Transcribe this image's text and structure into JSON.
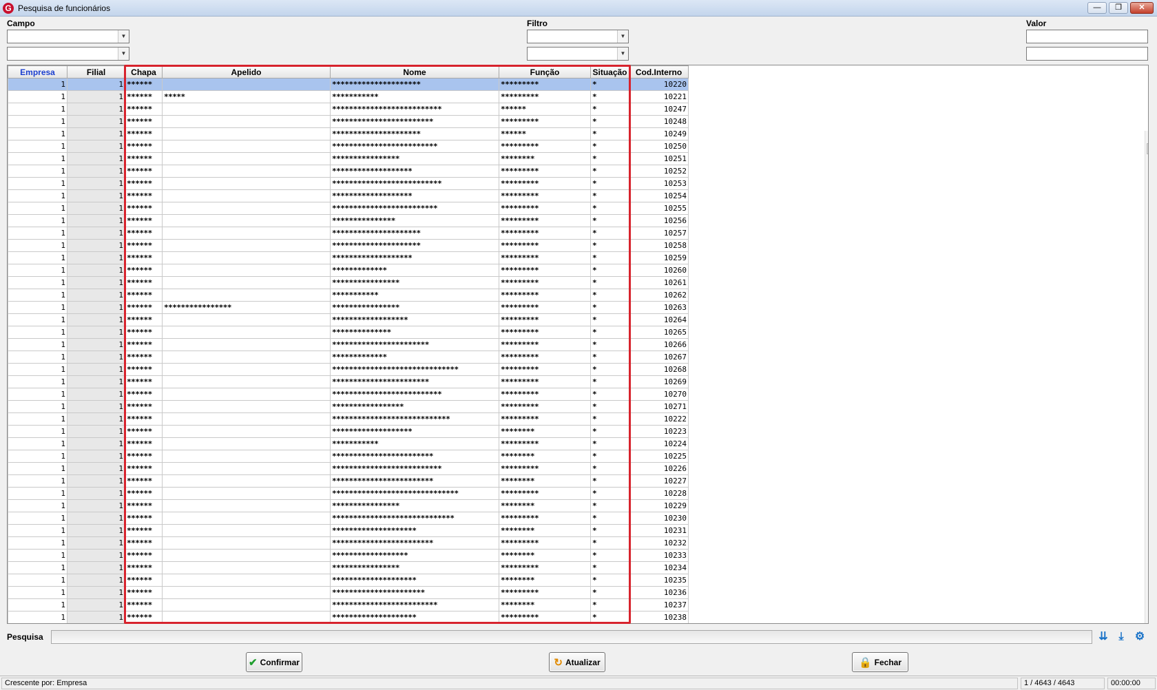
{
  "window": {
    "title": "Pesquisa de funcionários",
    "icon_letter": "G",
    "minimize": "—",
    "restore": "❐",
    "close": "✕"
  },
  "filters": {
    "campo_label": "Campo",
    "filtro_label": "Filtro",
    "valor_label": "Valor"
  },
  "grid": {
    "columns": [
      "Empresa",
      "Filial",
      "Chapa",
      "Apelido",
      "Nome",
      "Função",
      "Situação",
      "Cod.Interno"
    ],
    "rows": [
      [
        "1",
        "1",
        "******",
        "",
        "*********************",
        "*********",
        "*",
        "10220"
      ],
      [
        "1",
        "1",
        "******",
        "*****",
        "***********",
        "*********",
        "*",
        "10221"
      ],
      [
        "1",
        "1",
        "******",
        "",
        "**************************",
        "******",
        "*",
        "10247"
      ],
      [
        "1",
        "1",
        "******",
        "",
        "************************",
        "*********",
        "*",
        "10248"
      ],
      [
        "1",
        "1",
        "******",
        "",
        "*********************",
        "******",
        "*",
        "10249"
      ],
      [
        "1",
        "1",
        "******",
        "",
        "*************************",
        "*********",
        "*",
        "10250"
      ],
      [
        "1",
        "1",
        "******",
        "",
        "****************",
        "********",
        "*",
        "10251"
      ],
      [
        "1",
        "1",
        "******",
        "",
        "*******************",
        "*********",
        "*",
        "10252"
      ],
      [
        "1",
        "1",
        "******",
        "",
        "**************************",
        "*********",
        "*",
        "10253"
      ],
      [
        "1",
        "1",
        "******",
        "",
        "*******************",
        "*********",
        "*",
        "10254"
      ],
      [
        "1",
        "1",
        "******",
        "",
        "*************************",
        "*********",
        "*",
        "10255"
      ],
      [
        "1",
        "1",
        "******",
        "",
        "***************",
        "*********",
        "*",
        "10256"
      ],
      [
        "1",
        "1",
        "******",
        "",
        "*********************",
        "*********",
        "*",
        "10257"
      ],
      [
        "1",
        "1",
        "******",
        "",
        "*********************",
        "*********",
        "*",
        "10258"
      ],
      [
        "1",
        "1",
        "******",
        "",
        "*******************",
        "*********",
        "*",
        "10259"
      ],
      [
        "1",
        "1",
        "******",
        "",
        "*************",
        "*********",
        "*",
        "10260"
      ],
      [
        "1",
        "1",
        "******",
        "",
        "****************",
        "*********",
        "*",
        "10261"
      ],
      [
        "1",
        "1",
        "******",
        "",
        "***********",
        "*********",
        "*",
        "10262"
      ],
      [
        "1",
        "1",
        "******",
        "****************",
        "****************",
        "*********",
        "*",
        "10263"
      ],
      [
        "1",
        "1",
        "******",
        "",
        "******************",
        "*********",
        "*",
        "10264"
      ],
      [
        "1",
        "1",
        "******",
        "",
        "**************",
        "*********",
        "*",
        "10265"
      ],
      [
        "1",
        "1",
        "******",
        "",
        "***********************",
        "*********",
        "*",
        "10266"
      ],
      [
        "1",
        "1",
        "******",
        "",
        "*************",
        "*********",
        "*",
        "10267"
      ],
      [
        "1",
        "1",
        "******",
        "",
        "******************************",
        "*********",
        "*",
        "10268"
      ],
      [
        "1",
        "1",
        "******",
        "",
        "***********************",
        "*********",
        "*",
        "10269"
      ],
      [
        "1",
        "1",
        "******",
        "",
        "**************************",
        "*********",
        "*",
        "10270"
      ],
      [
        "1",
        "1",
        "******",
        "",
        "*****************",
        "*********",
        "*",
        "10271"
      ],
      [
        "1",
        "1",
        "******",
        "",
        "****************************",
        "*********",
        "*",
        "10222"
      ],
      [
        "1",
        "1",
        "******",
        "",
        "*******************",
        "********",
        "*",
        "10223"
      ],
      [
        "1",
        "1",
        "******",
        "",
        "***********",
        "*********",
        "*",
        "10224"
      ],
      [
        "1",
        "1",
        "******",
        "",
        "************************",
        "********",
        "*",
        "10225"
      ],
      [
        "1",
        "1",
        "******",
        "",
        "**************************",
        "*********",
        "*",
        "10226"
      ],
      [
        "1",
        "1",
        "******",
        "",
        "************************",
        "********",
        "*",
        "10227"
      ],
      [
        "1",
        "1",
        "******",
        "",
        "******************************",
        "*********",
        "*",
        "10228"
      ],
      [
        "1",
        "1",
        "******",
        "",
        "****************",
        "********",
        "*",
        "10229"
      ],
      [
        "1",
        "1",
        "******",
        "",
        "*****************************",
        "*********",
        "*",
        "10230"
      ],
      [
        "1",
        "1",
        "******",
        "",
        "********************",
        "********",
        "*",
        "10231"
      ],
      [
        "1",
        "1",
        "******",
        "",
        "************************",
        "*********",
        "*",
        "10232"
      ],
      [
        "1",
        "1",
        "******",
        "",
        "******************",
        "********",
        "*",
        "10233"
      ],
      [
        "1",
        "1",
        "******",
        "",
        "****************",
        "*********",
        "*",
        "10234"
      ],
      [
        "1",
        "1",
        "******",
        "",
        "********************",
        "********",
        "*",
        "10235"
      ],
      [
        "1",
        "1",
        "******",
        "",
        "**********************",
        "*********",
        "*",
        "10236"
      ],
      [
        "1",
        "1",
        "******",
        "",
        "*************************",
        "********",
        "*",
        "10237"
      ],
      [
        "1",
        "1",
        "******",
        "",
        "********************",
        "*********",
        "*",
        "10238"
      ]
    ]
  },
  "search": {
    "label": "Pesquisa"
  },
  "toolbar_icons": [
    "chevron-double-down-icon",
    "jump-to-end-icon",
    "gear-icon"
  ],
  "buttons": {
    "confirmar": "Confirmar",
    "atualizar": "Atualizar",
    "fechar": "Fechar"
  },
  "status": {
    "order": "Crescente por: Empresa",
    "count": "1 / 4643 / 4643",
    "time": "00:00:00"
  },
  "colors": {
    "selected_row": "#a9c4ee",
    "highlight_border": "#d7232d",
    "sorted_header": "#1c3fcf"
  }
}
